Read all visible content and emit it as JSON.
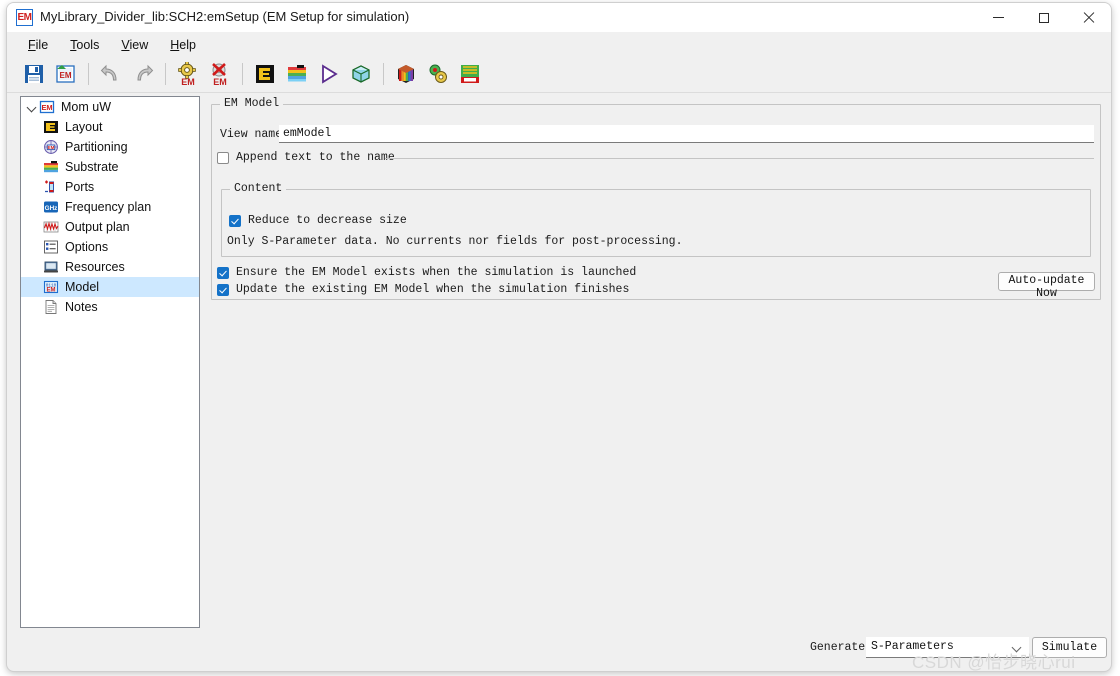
{
  "window": {
    "title": "MyLibrary_Divider_lib:SCH2:emSetup (EM Setup for simulation)",
    "app_icon": "em-icon",
    "controls": {
      "minimize": "minimize-icon",
      "maximize": "maximize-icon",
      "close": "close-icon"
    }
  },
  "menubar": {
    "items": [
      {
        "label": "File",
        "accel": "F"
      },
      {
        "label": "Tools",
        "accel": "T"
      },
      {
        "label": "View",
        "accel": "V"
      },
      {
        "label": "Help",
        "accel": "H"
      }
    ]
  },
  "toolbar": {
    "items": [
      {
        "name": "save-icon",
        "tip": "Save"
      },
      {
        "name": "save-em-icon",
        "tip": "Save EM Setup"
      },
      {
        "name": "undo-icon",
        "tip": "Undo"
      },
      {
        "name": "redo-icon",
        "tip": "Redo"
      },
      {
        "name": "em-settings-icon",
        "tip": "EM Settings"
      },
      {
        "name": "em-delete-icon",
        "tip": "Delete EM"
      },
      {
        "name": "layout-icon",
        "tip": "Layout"
      },
      {
        "name": "substrate-icon",
        "tip": "Substrate"
      },
      {
        "name": "simulate-icon",
        "tip": "Simulate"
      },
      {
        "name": "mesh-3d-icon",
        "tip": "3D Mesh"
      },
      {
        "name": "rainbow-cube-icon",
        "tip": "EM Visualization"
      },
      {
        "name": "em-cosimulation-icon",
        "tip": "Cosimulation"
      },
      {
        "name": "em-layout-view-icon",
        "tip": "EM Layout View"
      }
    ]
  },
  "tree": {
    "root": {
      "label": "Mom uW",
      "icon": "em-icon",
      "expanded": true
    },
    "items": [
      {
        "label": "Layout",
        "icon": "layout-icon",
        "selected": false
      },
      {
        "label": "Partitioning",
        "icon": "partitioning-icon",
        "selected": false
      },
      {
        "label": "Substrate",
        "icon": "substrate-icon",
        "selected": false
      },
      {
        "label": "Ports",
        "icon": "ports-icon",
        "selected": false
      },
      {
        "label": "Frequency plan",
        "icon": "frequency-plan-icon",
        "selected": false
      },
      {
        "label": "Output plan",
        "icon": "output-plan-icon",
        "selected": false
      },
      {
        "label": "Options",
        "icon": "options-icon",
        "selected": false
      },
      {
        "label": "Resources",
        "icon": "resources-icon",
        "selected": false
      },
      {
        "label": "Model",
        "icon": "model-icon",
        "selected": true
      },
      {
        "label": "Notes",
        "icon": "notes-icon",
        "selected": false
      }
    ]
  },
  "em_model": {
    "group_label": "EM Model",
    "view_name_label": "View name:",
    "view_name_value": "emModel",
    "append_text_label": "Append text to the name",
    "append_text_checked": false,
    "content": {
      "group_label": "Content",
      "reduce_label": "Reduce to decrease size",
      "reduce_checked": true,
      "description": "Only S-Parameter data. No currents nor fields for post-processing."
    },
    "ensure_label": "Ensure the EM Model exists when the simulation is launched",
    "ensure_checked": true,
    "update_label": "Update the existing EM Model when the simulation finishes",
    "update_checked": true,
    "auto_update_button": "Auto-update Now"
  },
  "bottom_bar": {
    "generate_label": "Generate:",
    "generate_value": "S-Parameters",
    "generate_options": [
      "S-Parameters"
    ],
    "simulate_button": "Simulate"
  },
  "watermark": "CSDN @怡步晓心rui",
  "colors": {
    "window_bg": "#f0f0f0",
    "panel_bg": "#ffffff",
    "selection": "#cde8ff",
    "checkbox_accent": "#1472c8",
    "border": "#c4c4c4",
    "title_text": "#1a1a1a"
  }
}
